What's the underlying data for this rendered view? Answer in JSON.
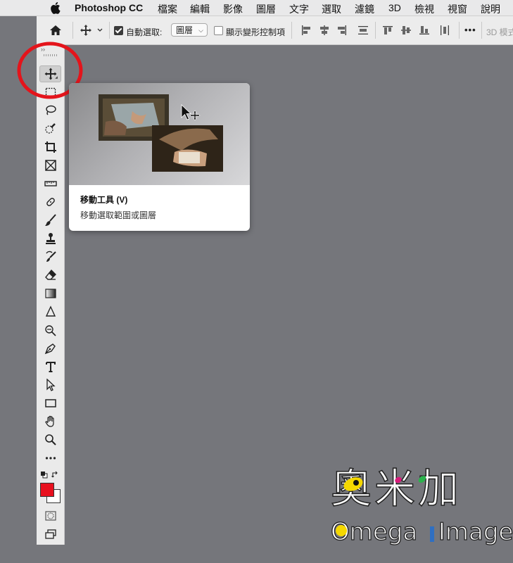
{
  "menubar": {
    "app_name": "Photoshop CC",
    "items": [
      "檔案",
      "編輯",
      "影像",
      "圖層",
      "文字",
      "選取",
      "濾鏡",
      "3D",
      "檢視",
      "視窗",
      "說明"
    ]
  },
  "options_bar": {
    "auto_select_label": "自動選取:",
    "auto_select_checked": true,
    "auto_select_target": "圖層",
    "show_transform_label": "顯示變形控制項",
    "show_transform_checked": false,
    "more": "•••",
    "mode_3d_label": "3D 模式"
  },
  "toolbox": {
    "collapse_glyph": "››",
    "active_tool": "move-tool",
    "tools": [
      "move",
      "marquee",
      "lasso",
      "quick-select",
      "crop",
      "frame",
      "ruler",
      "healing",
      "brush",
      "stamp",
      "history-brush",
      "eraser",
      "gradient",
      "blur",
      "dodge",
      "pen",
      "type",
      "path-select",
      "rectangle",
      "hand",
      "zoom",
      "more"
    ],
    "foreground_color": "#e8101e",
    "background_color": "#ffffff"
  },
  "tooltip": {
    "title": "移動工具 (V)",
    "description": "移動選取範圍或圖層"
  },
  "logo": {
    "cjk": "奧米加",
    "latin_start": "Omega",
    "latin_end": "Image"
  },
  "annotation": {
    "color": "#e4141b"
  }
}
